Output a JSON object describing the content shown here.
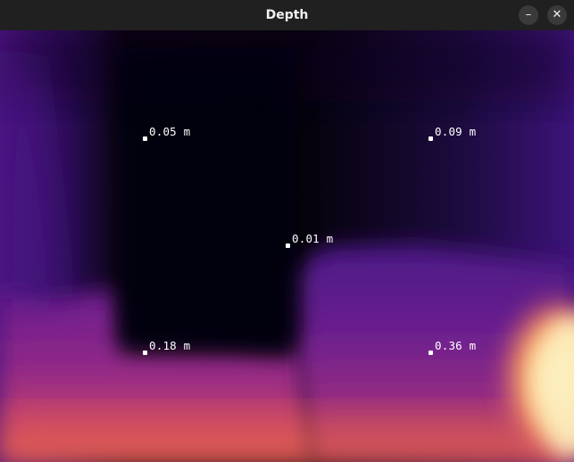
{
  "window": {
    "title": "Depth",
    "minimize_icon": "minimize-icon",
    "close_icon": "close-icon",
    "minimize_glyph": "–",
    "close_glyph": "✕"
  },
  "depth_map": {
    "colormap": "magma",
    "colors": {
      "near": "#000004",
      "dark": "#140a2e",
      "mid_purple": "#5a1a8a",
      "magenta": "#a12f7f",
      "orange": "#e8604a",
      "far": "#fcf6c5"
    },
    "measurements": [
      {
        "label": "0.05 m"
      },
      {
        "label": "0.09 m"
      },
      {
        "label": "0.01 m"
      },
      {
        "label": "0.18 m"
      },
      {
        "label": "0.36 m"
      }
    ]
  }
}
